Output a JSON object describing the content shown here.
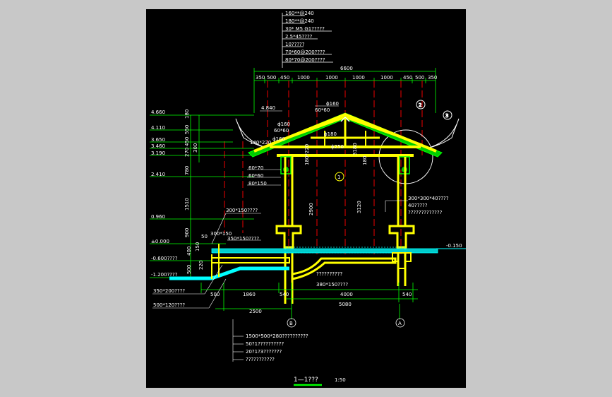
{
  "notes_top": [
    "160**@240",
    "180**@240",
    "30* M5 G1?????",
    "2.5*45????",
    "10?????",
    "70*60@200????",
    "80*70@200????"
  ],
  "dims_top": {
    "total": "6600",
    "segments": [
      "350",
      "500",
      "450",
      "1000",
      "1000",
      "1000",
      "1000",
      "450",
      "500",
      "350"
    ]
  },
  "elevations": [
    "4.660",
    "4.110",
    "3.650",
    "3.460",
    "3.190",
    "2.410",
    "0.960",
    "±0.000",
    "-0.600????",
    "-1.200????"
  ],
  "elevation_right": "-0.150",
  "vdims_left": [
    "180",
    "550",
    "450",
    "270",
    "200",
    "780",
    "1510",
    "900",
    "400",
    "500"
  ],
  "vdim_300": "300",
  "vdims_left_inner": [
    "150",
    "220"
  ],
  "labels_struct": [
    "4.840",
    "ϕ160",
    "60*60",
    "ϕ160",
    "60*60",
    "ϕ180",
    "140*220",
    "ϕ160",
    "ϕ250",
    "60*70",
    "60*60",
    "80*150",
    "180*220"
  ],
  "center_dims": [
    "2900",
    "3120",
    "3180",
    "180"
  ],
  "callouts_left": [
    "300*150????",
    "50",
    "300*150",
    "350*150????",
    "350*200????",
    "500*120????"
  ],
  "callouts_right": [
    "300*300*40????",
    "40?????",
    "?????????????"
  ],
  "beam_labels": [
    "??????????",
    "380*150????"
  ],
  "dims_bottom": [
    "500",
    "1860",
    "540",
    "4000",
    "540",
    "5080",
    "2500"
  ],
  "axis_labels": [
    "B",
    "A",
    "1",
    "2",
    "3"
  ],
  "notes_bottom": [
    "1500*500*280??????????",
    "50?1??????????",
    "20?1?3???????",
    "???????????"
  ],
  "title": "1—1???",
  "scale": "1:50"
}
